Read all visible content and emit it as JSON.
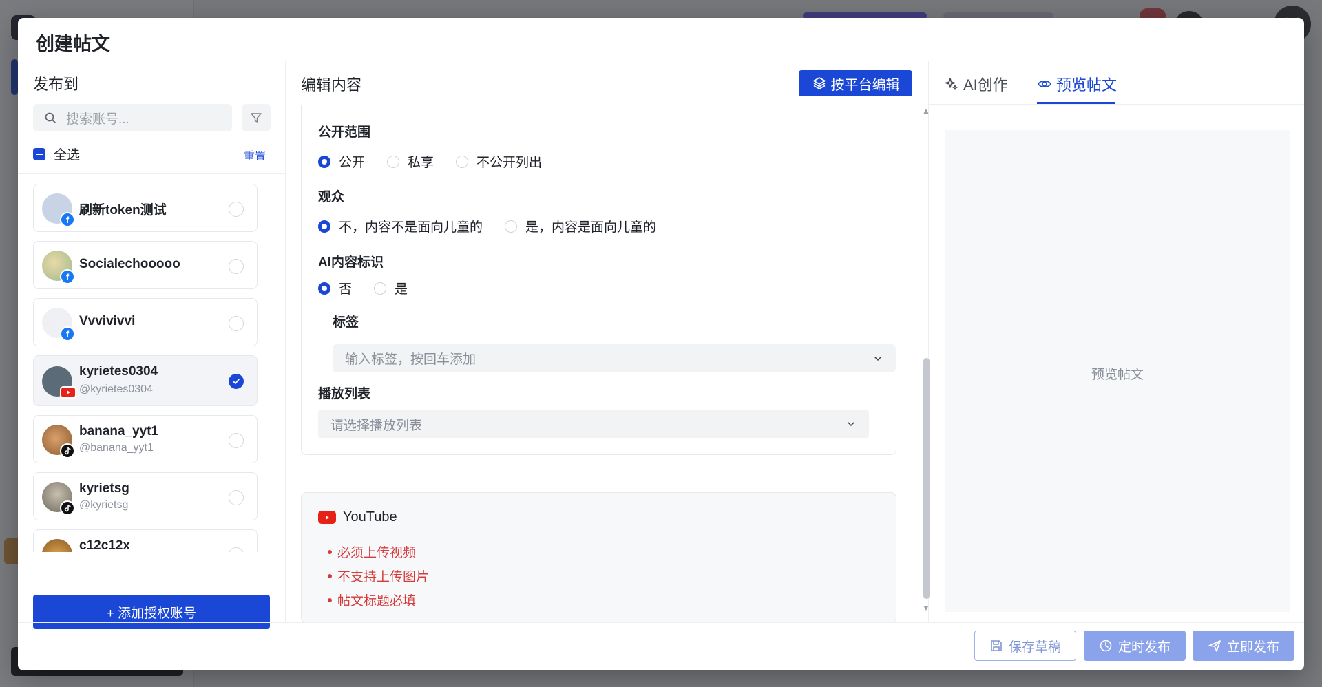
{
  "modal": {
    "title": "创建帖文"
  },
  "left": {
    "title": "发布到",
    "search_placeholder": "搜索账号...",
    "select_all": "全选",
    "reset": "重置",
    "accounts": [
      {
        "name": "刷新token测试",
        "handle": "",
        "platform": "facebook",
        "selected": false
      },
      {
        "name": "Socialechooooo",
        "handle": "",
        "platform": "facebook",
        "selected": false
      },
      {
        "name": "Vvvivivvi",
        "handle": "",
        "platform": "facebook",
        "selected": false
      },
      {
        "name": "kyrietes0304",
        "handle": "@kyrietes0304",
        "platform": "youtube",
        "selected": true
      },
      {
        "name": "banana_yyt1",
        "handle": "@banana_yyt1",
        "platform": "tiktok",
        "selected": false
      },
      {
        "name": "kyrietsg",
        "handle": "@kyrietsg",
        "platform": "tiktok",
        "selected": false
      },
      {
        "name": "c12c12x",
        "handle": "",
        "platform": "tiktok",
        "selected": false
      }
    ],
    "add_account": "+ 添加授权账号"
  },
  "middle": {
    "title": "编辑内容",
    "platform_edit": "按平台编辑",
    "visibility": {
      "label": "公开范围",
      "options": [
        "公开",
        "私享",
        "不公开列出"
      ],
      "selected": 0
    },
    "audience": {
      "label": "观众",
      "options": [
        "不，内容不是面向儿童的",
        "是，内容是面向儿童的"
      ],
      "selected": 0
    },
    "ai_label": {
      "label": "AI内容标识",
      "options": [
        "否",
        "是"
      ],
      "selected": 0
    },
    "tags": {
      "label": "标签",
      "placeholder": "输入标签，按回车添加"
    },
    "playlist": {
      "label": "播放列表",
      "placeholder": "请选择播放列表"
    },
    "youtube_card": {
      "platform": "YouTube",
      "requirements": [
        "必须上传视频",
        "不支持上传图片",
        "帖文标题必填"
      ]
    }
  },
  "right": {
    "tab_ai": "AI创作",
    "tab_preview": "预览帖文",
    "preview_placeholder": "预览帖文"
  },
  "footer": {
    "save_draft": "保存草稿",
    "schedule": "定时发布",
    "publish_now": "立即发布"
  },
  "colors": {
    "primary": "#1a47d6",
    "danger": "#d63b3b",
    "youtube": "#e62117",
    "facebook": "#1877f2"
  }
}
